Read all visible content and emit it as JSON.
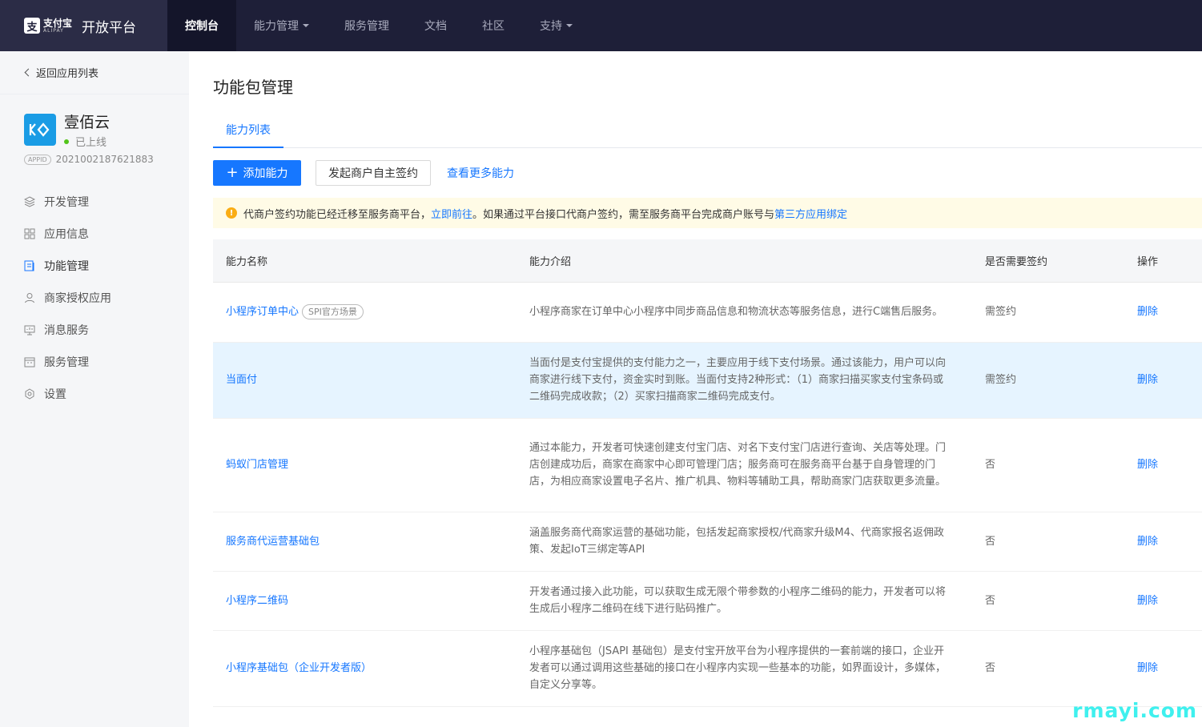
{
  "topbar": {
    "brand_cn": "支付宝",
    "brand_en": "ALIPAY",
    "brand_mark": "支",
    "title": "开放平台",
    "nav": [
      {
        "label": "控制台",
        "active": true,
        "dropdown": false
      },
      {
        "label": "能力管理",
        "active": false,
        "dropdown": true
      },
      {
        "label": "服务管理",
        "active": false,
        "dropdown": false
      },
      {
        "label": "文档",
        "active": false,
        "dropdown": false
      },
      {
        "label": "社区",
        "active": false,
        "dropdown": false
      },
      {
        "label": "支持",
        "active": false,
        "dropdown": true
      }
    ]
  },
  "sidebar": {
    "back_label": "返回应用列表",
    "app": {
      "name": "壹佰云",
      "status": "已上线",
      "appid_tag": "APPID",
      "appid": "2021002187621883",
      "logo_text": "K"
    },
    "menu": [
      {
        "label": "开发管理",
        "icon": "layers-icon"
      },
      {
        "label": "应用信息",
        "icon": "grid-icon"
      },
      {
        "label": "功能管理",
        "icon": "function-icon"
      },
      {
        "label": "商家授权应用",
        "icon": "user-icon"
      },
      {
        "label": "消息服务",
        "icon": "monitor-icon"
      },
      {
        "label": "服务管理",
        "icon": "calendar-icon"
      },
      {
        "label": "设置",
        "icon": "gear-icon"
      }
    ]
  },
  "main": {
    "title": "功能包管理",
    "tab": "能力列表",
    "buttons": {
      "add": "添加能力",
      "merchant_sign": "发起商户自主签约",
      "more": "查看更多能力"
    },
    "alert": {
      "text1": "代商户签约功能已经迁移至服务商平台，",
      "link1": "立即前往",
      "text2": "。如果通过平台接口代商户签约，需至服务商平台完成商户账号与",
      "link2": "第三方应用绑定"
    },
    "table": {
      "headers": [
        "能力名称",
        "能力介绍",
        "是否需要签约",
        "操作"
      ],
      "rows": [
        {
          "name": "小程序订单中心",
          "tag": "SPI官方场景",
          "desc": "小程序商家在订单中心小程序中同步商品信息和物流状态等服务信息，进行C端售后服务。",
          "sign": "需签约",
          "op": "删除"
        },
        {
          "name": "当面付",
          "tag": "",
          "desc": "当面付是支付宝提供的支付能力之一，主要应用于线下支付场景。通过该能力，用户可以向商家进行线下支付，资金实时到账。当面付支持2种形式：（1）商家扫描买家支付宝条码或二维码完成收款；（2）买家扫描商家二维码完成支付。",
          "sign": "需签约",
          "op": "删除"
        },
        {
          "name": "蚂蚁门店管理",
          "tag": "",
          "desc": "通过本能力，开发者可快速创建支付宝门店、对名下支付宝门店进行查询、关店等处理。门店创建成功后，商家在商家中心即可管理门店；服务商可在服务商平台基于自身管理的门店，为相应商家设置电子名片、推广机具、物料等辅助工具，帮助商家门店获取更多流量。",
          "sign": "否",
          "op": "删除"
        },
        {
          "name": "服务商代运营基础包",
          "tag": "",
          "desc": "涵盖服务商代商家运营的基础功能，包括发起商家授权/代商家升级M4、代商家报名返佣政策、发起IoT三绑定等API",
          "sign": "否",
          "op": "删除"
        },
        {
          "name": "小程序二维码",
          "tag": "",
          "desc": "开发者通过接入此功能，可以获取生成无限个带参数的小程序二维码的能力，开发者可以将生成后小程序二维码在线下进行贴码推广。",
          "sign": "否",
          "op": "删除"
        },
        {
          "name": "小程序基础包（企业开发者版）",
          "tag": "",
          "desc": "小程序基础包（JSAPI 基础包）是支付宝开放平台为小程序提供的一套前端的接口，企业开发者可以通过调用这些基础的接口在小程序内实现一些基本的功能，如界面设计，多媒体，自定义分享等。",
          "sign": "否",
          "op": "删除"
        }
      ]
    }
  },
  "watermark": "rmayi.com",
  "colors": {
    "nav_bg": "#1e1f38",
    "accent": "#1677ff",
    "highlight_row": "#e6f4ff",
    "alert_bg": "#fffbe6",
    "online": "#52c41a"
  }
}
